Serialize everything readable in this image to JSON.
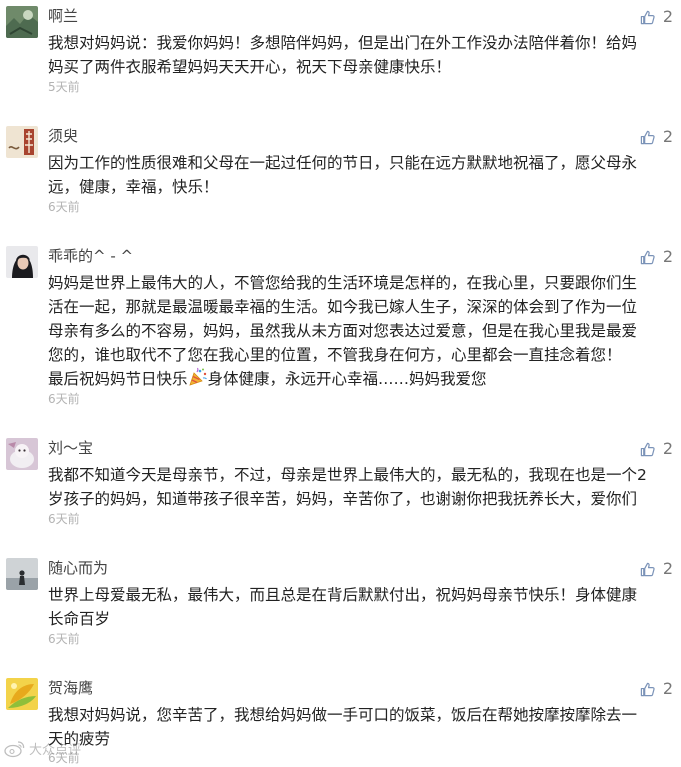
{
  "comments": [
    {
      "username": "啊兰",
      "likes": "2",
      "lines": [
        "我想对妈妈说：我爱你妈妈！多想陪伴妈妈，但是出门在外工作没办法陪伴着你！给妈",
        "妈买了两件衣服希望妈妈天天开心，祝天下母亲健康快乐！"
      ],
      "time": "5天前"
    },
    {
      "username": "须臾",
      "likes": "2",
      "lines": [
        "因为工作的性质很难和父母在一起过任何的节日，只能在远方默默地祝福了，愿父母永",
        "远，健康，幸福，快乐！"
      ],
      "time": "6天前"
    },
    {
      "username": "乖乖的^ - ^",
      "likes": "2",
      "lines": [
        "妈妈是世界上最伟大的人，不管您给我的生活环境是怎样的，在我心里，只要跟你们生",
        "活在一起，那就是最温暖最幸福的生活。如今我已嫁人生子，深深的体会到了作为一位",
        "母亲有多么的不容易，妈妈，虽然我从未方面对您表达过爱意，但是在我心里我是最爱",
        "您的，谁也取代不了您在我心里的位置，不管我身在何方，心里都会一直挂念着您！"
      ],
      "last_line_a": "最后祝妈妈节日快乐",
      "last_line_b": "身体健康，永远开心幸福……妈妈我爱您",
      "time": "6天前"
    },
    {
      "username": "刘～宝",
      "likes": "2",
      "lines": [
        "我都不知道今天是母亲节，不过，母亲是世界上最伟大的，最无私的，我现在也是一个2",
        "岁孩子的妈妈，知道带孩子很辛苦，妈妈，辛苦你了，也谢谢你把我抚养长大，爱你们"
      ],
      "time": "6天前"
    },
    {
      "username": "随心而为",
      "likes": "2",
      "lines": [
        "世界上母爱最无私，最伟大，而且总是在背后默默付出，祝妈妈母亲节快乐！身体健康",
        "长命百岁"
      ],
      "time": "6天前"
    },
    {
      "username": "贺海鹰",
      "likes": "2",
      "lines": [
        "我想对妈妈说，您辛苦了，我想给妈妈做一手可口的饭菜，饭后在帮她按摩按摩除去一",
        "天的疲劳"
      ],
      "time": "6天前"
    }
  ],
  "watermark": "大众点评",
  "icons": {
    "like": "thumbs-up-icon",
    "party": "party-popper-icon"
  },
  "colors": {
    "like_icon": "#7b93b8",
    "time": "#b3b3b3"
  }
}
